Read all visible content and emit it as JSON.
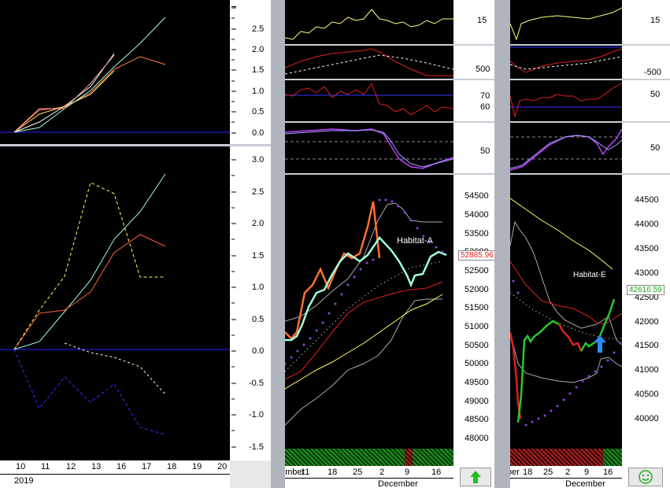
{
  "left": {
    "top_ticks": [
      "2.5",
      "2.0",
      "1.5",
      "1.0",
      "0.5",
      "0.0"
    ],
    "bottom_ticks": [
      "3.0",
      "2.5",
      "2.0",
      "1.5",
      "1.0",
      "0.5",
      "0.0",
      "-0.5",
      "-1.0",
      "-1.5"
    ],
    "x_ticks": [
      "10",
      "11",
      "12",
      "13",
      "16",
      "17",
      "18",
      "19",
      "20"
    ],
    "year_label": "2019"
  },
  "middle": {
    "ind1_ticks": [
      "15"
    ],
    "ind2_ticks": [
      "500"
    ],
    "ind3_ticks": [
      "70",
      "60"
    ],
    "ind4_ticks": [
      "50"
    ],
    "price_ticks": [
      "54500",
      "54000",
      "53500",
      "53000",
      "52500",
      "52000",
      "51500",
      "51000",
      "50500",
      "50000",
      "49500",
      "49000",
      "48500",
      "48000"
    ],
    "price_label": "52885.96",
    "chart_label": "Habitat-A",
    "x_ticks": [
      "ember",
      "11",
      "18",
      "25",
      "2",
      "9",
      "16"
    ],
    "month_label": "December",
    "arrow_icon": "up-arrow-icon"
  },
  "right": {
    "ind1_ticks": [
      "15"
    ],
    "ind2_ticks": [
      "-500"
    ],
    "ind3_ticks": [
      "50"
    ],
    "ind4_ticks": [
      "50"
    ],
    "price_ticks": [
      "44500",
      "44000",
      "43500",
      "43000",
      "42500",
      "42000",
      "41500",
      "41000",
      "40500",
      "40000"
    ],
    "price_label": "42616.59",
    "chart_label": "Habitat-E",
    "x_ticks": [
      "ber",
      "18",
      "25",
      "2",
      "9",
      "16"
    ],
    "month_label": "December",
    "smiley_icon": "smiley-icon"
  },
  "colors": {
    "up_green": "#28c828",
    "down_red": "#e02020",
    "signal_blue": "#2a8cff"
  }
}
